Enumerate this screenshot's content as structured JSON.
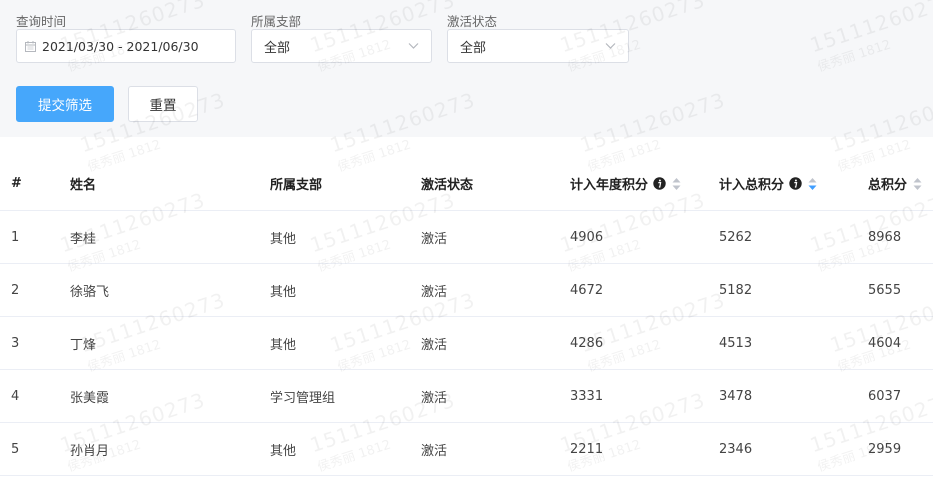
{
  "filters": {
    "date_label": "查询时间",
    "date_value": "2021/03/30 - 2021/06/30",
    "branch_label": "所属支部",
    "branch_value": "全部",
    "status_label": "激活状态",
    "status_value": "全部"
  },
  "buttons": {
    "submit": "提交筛选",
    "reset": "重置"
  },
  "table": {
    "headers": {
      "index": "#",
      "name": "姓名",
      "branch": "所属支部",
      "status": "激活状态",
      "annual_points": "计入年度积分",
      "total_points_counted": "计入总积分",
      "total_points": "总积分"
    },
    "rows": [
      {
        "index": "1",
        "name": "李桂",
        "branch": "其他",
        "status": "激活",
        "annual": "4906",
        "counted": "5262",
        "total": "8968"
      },
      {
        "index": "2",
        "name": "徐骆飞",
        "branch": "其他",
        "status": "激活",
        "annual": "4672",
        "counted": "5182",
        "total": "5655"
      },
      {
        "index": "3",
        "name": "丁烽",
        "branch": "其他",
        "status": "激活",
        "annual": "4286",
        "counted": "4513",
        "total": "4604"
      },
      {
        "index": "4",
        "name": "张美霞",
        "branch": "学习管理组",
        "status": "激活",
        "annual": "3331",
        "counted": "3478",
        "total": "6037"
      },
      {
        "index": "5",
        "name": "孙肖月",
        "branch": "其他",
        "status": "激活",
        "annual": "2211",
        "counted": "2346",
        "total": "2959"
      }
    ]
  },
  "watermark": {
    "number": "15111260273",
    "text": "侯秀丽 1812"
  },
  "colors": {
    "primary": "#46a7fb",
    "sort_active": "#409eff",
    "sort_inactive": "#c0c4cc"
  }
}
